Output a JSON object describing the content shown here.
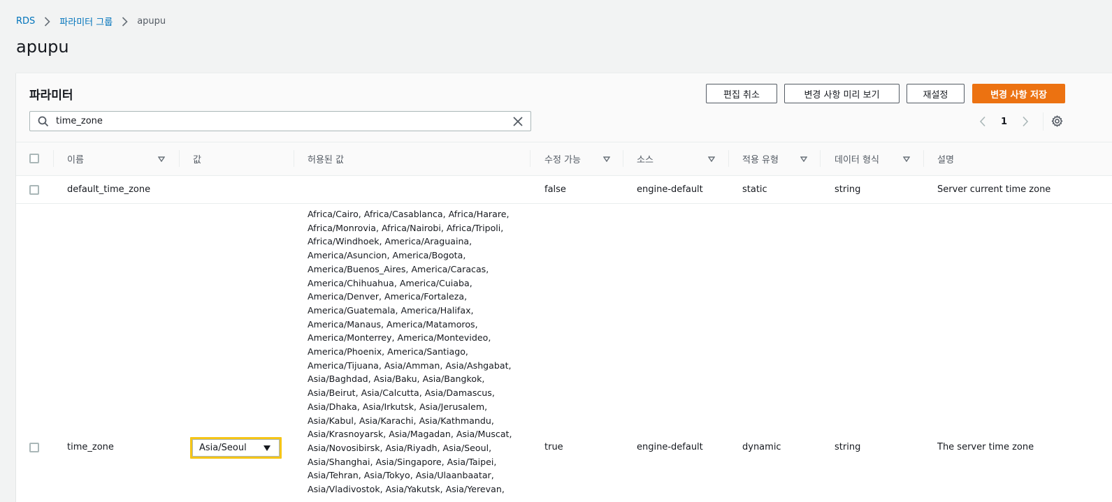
{
  "breadcrumb": {
    "items": [
      "RDS",
      "파라미터 그룹"
    ],
    "current": "apupu"
  },
  "page": {
    "title": "apupu"
  },
  "panel": {
    "title": "파라미터",
    "buttons": {
      "cancel_edit": "편집 취소",
      "preview_changes": "변경 사항 미리 보기",
      "reset": "재설정",
      "save_changes": "변경 사항 저장"
    },
    "search": {
      "value": "time_zone"
    },
    "pagination": {
      "page": "1"
    }
  },
  "table": {
    "columns": {
      "name": "이름",
      "value": "값",
      "allowed_values": "허용된 값",
      "modifiable": "수정 가능",
      "source": "소스",
      "apply_type": "적용 유형",
      "data_type": "데이터 형식",
      "description": "설명"
    },
    "rows": [
      {
        "name": "default_time_zone",
        "value": "",
        "allowed_values": "",
        "modifiable": "false",
        "source": "engine-default",
        "apply_type": "static",
        "data_type": "string",
        "description": "Server current time zone"
      },
      {
        "name": "time_zone",
        "value": "Asia/Seoul",
        "allowed_values": "Africa/Cairo, Africa/Casablanca, Africa/Harare, Africa/Monrovia, Africa/Nairobi, Africa/Tripoli, Africa/Windhoek, America/Araguaina, America/Asuncion, America/Bogota, America/Buenos_Aires, America/Caracas, America/Chihuahua, America/Cuiaba, America/Denver, America/Fortaleza, America/Guatemala, America/Halifax, America/Manaus, America/Matamoros, America/Monterrey, America/Montevideo, America/Phoenix, America/Santiago, America/Tijuana, Asia/Amman, Asia/Ashgabat, Asia/Baghdad, Asia/Baku, Asia/Bangkok, Asia/Beirut, Asia/Calcutta, Asia/Damascus, Asia/Dhaka, Asia/Irkutsk, Asia/Jerusalem, Asia/Kabul, Asia/Karachi, Asia/Kathmandu, Asia/Krasnoyarsk, Asia/Magadan, Asia/Muscat, Asia/Novosibirsk, Asia/Riyadh, Asia/Seoul, Asia/Shanghai, Asia/Singapore, Asia/Taipei, Asia/Tehran, Asia/Tokyo, Asia/Ulaanbaatar, Asia/Vladivostok, Asia/Yakutsk, Asia/Yerevan,",
        "modifiable": "true",
        "source": "engine-default",
        "apply_type": "dynamic",
        "data_type": "string",
        "description": "The server time zone"
      }
    ]
  },
  "colors": {
    "primary_button": "#ec7211",
    "link": "#0073bb",
    "highlight": "#f5c518"
  },
  "icons": [
    "chevron-right-icon",
    "search-icon",
    "clear-icon",
    "chevron-left-icon",
    "settings-gear-icon",
    "sort-caret-icon",
    "dropdown-caret-icon"
  ]
}
